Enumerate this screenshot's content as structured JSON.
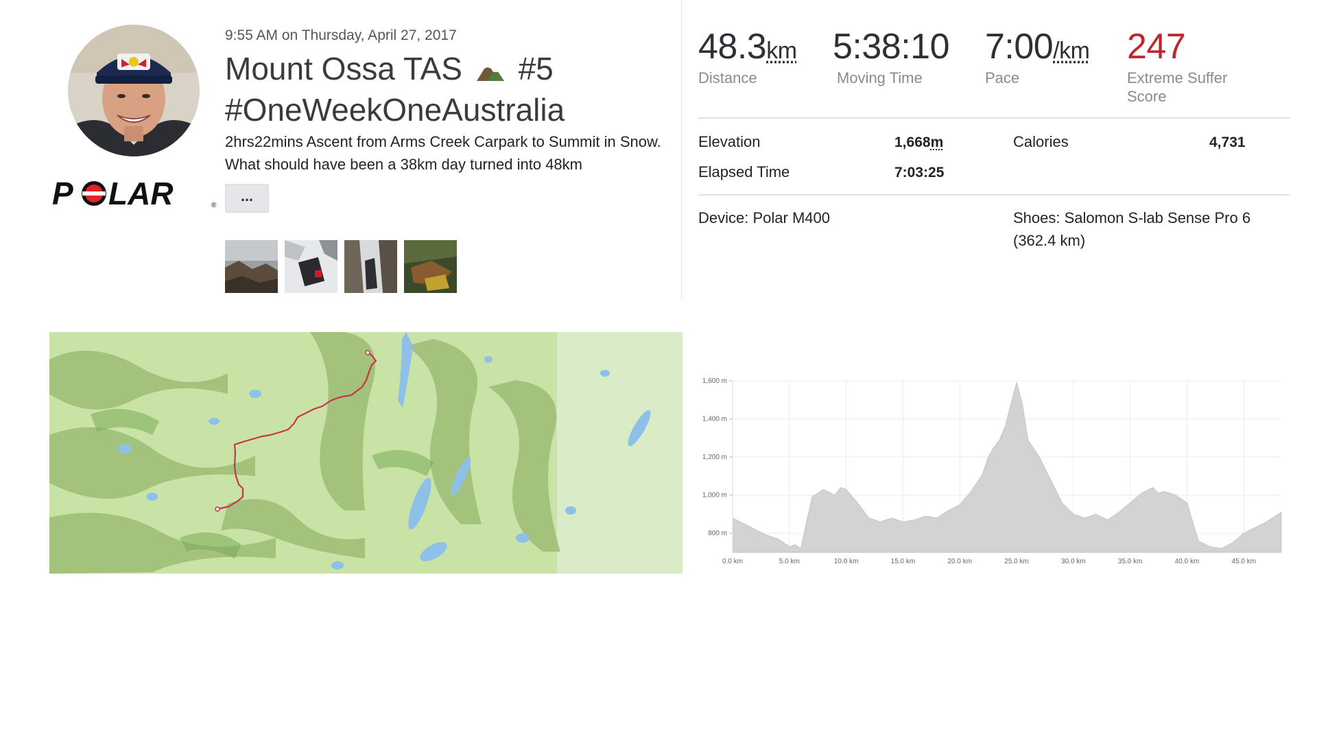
{
  "activity": {
    "timestamp": "9:55 AM on Thursday, April 27, 2017",
    "title_part1": "Mount Ossa TAS",
    "title_part2": "#5",
    "title_hashtag": "#OneWeekOneAustralia",
    "description": "2hrs22mins Ascent from Arms Creek Carpark to Summit in Snow. What should have been a 38km day turned into 48km",
    "more_label": "...",
    "brand_logo": "POLAR",
    "title_icon": "mountain-icon",
    "photo_count": 4
  },
  "stats": {
    "distance": {
      "value": "48.3",
      "unit": "km",
      "label": "Distance"
    },
    "moving_time": {
      "value": "5:38:10",
      "label": "Moving Time"
    },
    "pace": {
      "value": "7:00",
      "unit": "/km",
      "label": "Pace"
    },
    "suffer": {
      "value": "247",
      "label": "Extreme Suffer Score"
    },
    "elevation": {
      "label": "Elevation",
      "value": "1,668",
      "unit": "m"
    },
    "calories": {
      "label": "Calories",
      "value": "4,731"
    },
    "elapsed": {
      "label": "Elapsed Time",
      "value": "7:03:25"
    },
    "device": "Device: Polar M400",
    "shoes": "Shoes: Salomon S-lab Sense Pro 6 (362.4 km)"
  },
  "colors": {
    "suffer_red": "#c0262d",
    "map_green": "#c6e0a1",
    "route_red": "#c8344a",
    "chart_fill": "#d3d3d3"
  },
  "chart_data": {
    "type": "area",
    "title": "",
    "xlabel": "",
    "ylabel": "",
    "x_tick_labels": [
      "0.0 km",
      "5.0 km",
      "10.0 km",
      "15.0 km",
      "20.0 km",
      "25.0 km",
      "30.0 km",
      "35.0 km",
      "40.0 km",
      "45.0 km"
    ],
    "y_tick_labels": [
      "1,600 m",
      "1,400 m",
      "1,200 m",
      "1,000 m",
      "800 m"
    ],
    "xlim": [
      0,
      48.3
    ],
    "ylim": [
      700,
      1600
    ],
    "grid": true,
    "x": [
      0,
      1,
      2,
      3,
      4,
      5,
      5.5,
      6,
      7,
      8,
      9,
      9.5,
      10,
      11,
      12,
      13,
      14,
      15,
      16,
      17,
      18,
      19,
      20,
      21,
      22,
      22.5,
      23,
      23.5,
      24,
      24.5,
      25,
      25.5,
      26,
      27,
      28,
      29,
      30,
      31,
      32,
      33,
      34,
      35,
      36,
      37,
      37.5,
      38,
      39,
      40,
      41,
      42,
      43,
      44,
      45,
      46,
      47,
      48.3
    ],
    "y": [
      880,
      850,
      820,
      790,
      770,
      730,
      740,
      720,
      990,
      1030,
      1000,
      1040,
      1030,
      960,
      880,
      860,
      880,
      860,
      870,
      890,
      880,
      920,
      950,
      1020,
      1110,
      1200,
      1250,
      1290,
      1360,
      1480,
      1590,
      1480,
      1290,
      1200,
      1080,
      960,
      900,
      880,
      900,
      870,
      910,
      960,
      1010,
      1040,
      1010,
      1020,
      1000,
      960,
      760,
      730,
      720,
      750,
      800,
      830,
      860,
      910
    ]
  }
}
